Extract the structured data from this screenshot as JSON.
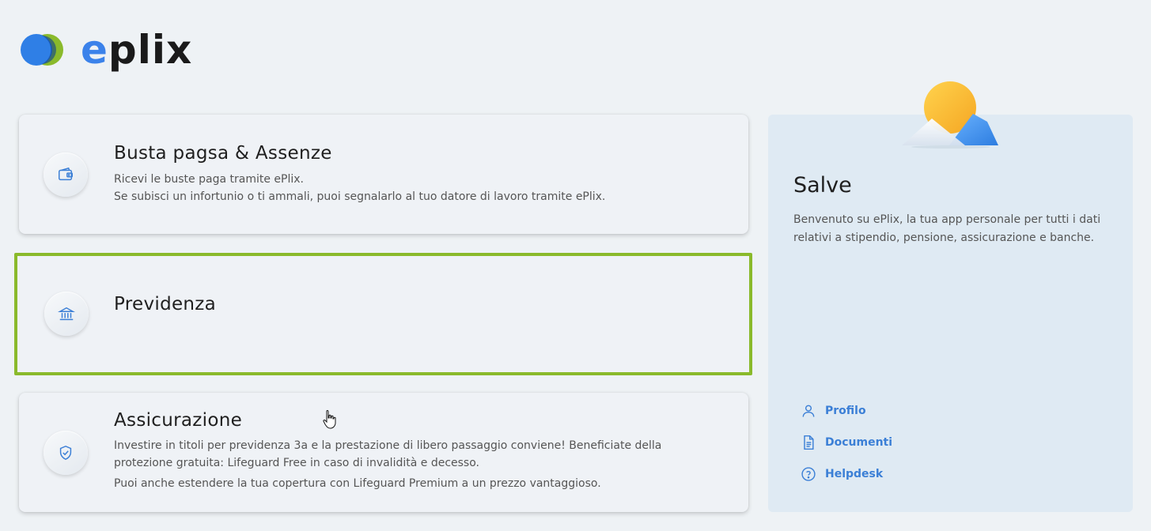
{
  "brand": {
    "name_prefix": "e",
    "name_rest": "plix",
    "colors": {
      "blue": "#3b82ea",
      "green": "#8aba2b"
    }
  },
  "cards": [
    {
      "icon": "wallet-icon",
      "title": "Busta pagsa & Assenze",
      "lines": [
        "Ricevi le buste paga tramite ePlix.",
        "Se subisci un infortunio o ti ammali, puoi segnalarlo al tuo datore di lavoro tramite ePlix."
      ]
    },
    {
      "icon": "bank-icon",
      "title": "Previdenza",
      "selected": true
    },
    {
      "icon": "shield-check-icon",
      "title": "Assicurazione",
      "paragraphs": [
        "Investire in titoli per previdenza 3a e la prestazione di libero passaggio conviene! Beneficiate della protezione gratuita: Lifeguard Free in caso di invalidità e decesso.",
        "Puoi anche estendere la tua copertura con Lifeguard Premium a un prezzo vantaggioso."
      ]
    }
  ],
  "side": {
    "title": "Salve",
    "text": "Benvenuto su ePlix, la tua app personale per tutti i dati relativi a stipendio, pensione, assicurazione e banche.",
    "links": [
      {
        "icon": "user-icon",
        "label": "Profilo"
      },
      {
        "icon": "document-icon",
        "label": "Documenti"
      },
      {
        "icon": "help-icon",
        "label": "Helpdesk"
      }
    ]
  }
}
